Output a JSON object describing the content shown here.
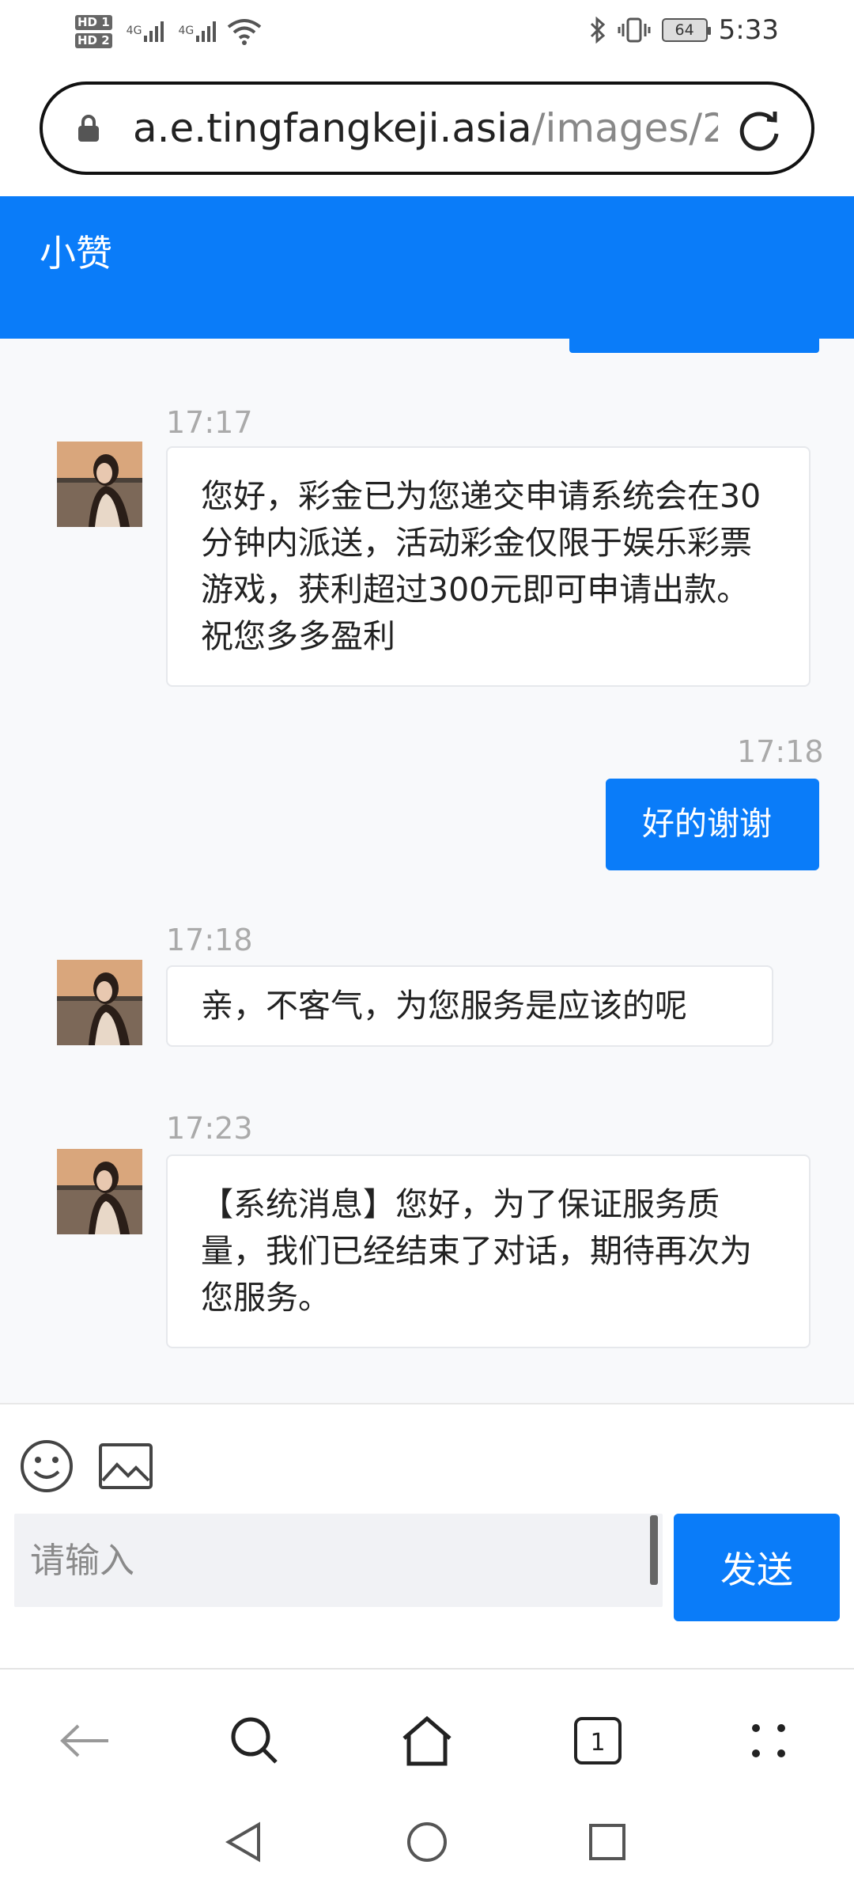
{
  "status_bar": {
    "hd1": "HD 1",
    "hd2": "HD 2",
    "net1": "4G",
    "net2": "4G",
    "battery": "64",
    "time": "5:33"
  },
  "browser": {
    "url_host": "a.e.tingfangkeji.asia",
    "url_path": "/images/2"
  },
  "chat": {
    "title": "小赞",
    "messages": [
      {
        "direction": "in",
        "time": "17:17",
        "text": "您好，彩金已为您递交申请系统会在30分钟内派送，活动彩金仅限于娱乐彩票游戏，获利超过300元即可申请出款。祝您多多盈利"
      },
      {
        "direction": "out",
        "time": "17:18",
        "text": "好的谢谢"
      },
      {
        "direction": "in",
        "time": "17:18",
        "text": "亲，不客气，为您服务是应该的呢"
      },
      {
        "direction": "in",
        "time": "17:23",
        "text": "【系统消息】您好，为了保证服务质量，我们已经结束了对话，期待再次为您服务。"
      }
    ]
  },
  "composer": {
    "placeholder": "请输入",
    "send_label": "发送"
  },
  "browser_nav": {
    "tabs_count": "1"
  },
  "colors": {
    "accent": "#0a7cf9",
    "chat_bg": "#f8f9fb"
  }
}
